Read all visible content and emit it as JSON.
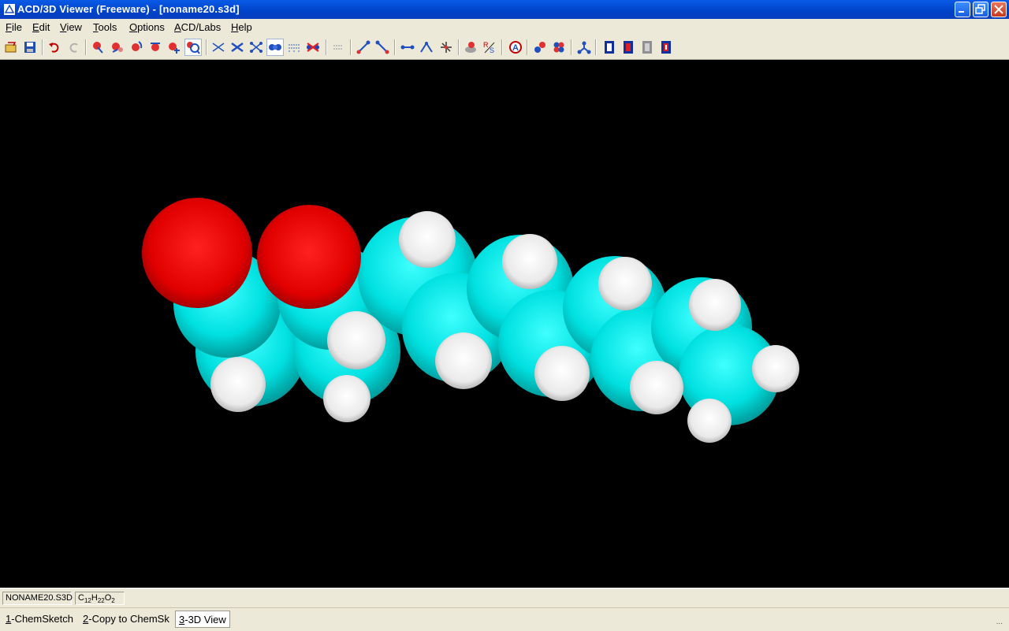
{
  "window": {
    "title": "ACD/3D Viewer (Freeware) - [noname20.s3d]"
  },
  "menu": {
    "items": [
      {
        "key": "F",
        "rest": "ile"
      },
      {
        "key": "E",
        "rest": "dit"
      },
      {
        "key": "V",
        "rest": "iew"
      },
      {
        "key": "T",
        "rest": "ools"
      },
      {
        "key": "O",
        "rest": "ptions"
      },
      {
        "key": "A",
        "rest": "CD/Labs"
      },
      {
        "key": "H",
        "rest": "elp"
      }
    ]
  },
  "toolbar": {
    "buttons": [
      "open-icon",
      "save-icon",
      "undo-icon",
      "redo-icon",
      "select-atom-icon",
      "move-icon",
      "rotate-icon",
      "rotate-z-icon",
      "translate-icon",
      "zoom-icon",
      "wireframe-icon",
      "sticks-icon",
      "balls-sticks-icon",
      "spacefill-icon",
      "dots-icon",
      "ribbons-icon",
      "surface-icon",
      "distance-icon",
      "angle-icon",
      "bond-length-icon",
      "bond-angle-icon",
      "torsion-icon",
      "optimize-icon",
      "stereo-rs-icon",
      "labels-icon",
      "color-atoms-icon",
      "color-molecule-icon",
      "hide-atoms-icon",
      "animation-icon",
      "movie-icon",
      "film-icon",
      "movie-export-icon"
    ]
  },
  "colors": {
    "carbon": "#00E5E5",
    "oxygen": "#E00000",
    "hydrogen": "#F2F2F2",
    "background": "#000000"
  },
  "status": {
    "filename": "NONAME20.S3D",
    "formula_parts": [
      "C",
      "12",
      "H",
      "22",
      "O",
      "2"
    ]
  },
  "tabs": [
    {
      "key": "1",
      "rest": "-ChemSketch",
      "active": false
    },
    {
      "key": "2",
      "rest": "-Copy to ChemSk",
      "active": false
    },
    {
      "key": "3",
      "rest": "-3D View",
      "active": true
    }
  ],
  "grip": "..."
}
